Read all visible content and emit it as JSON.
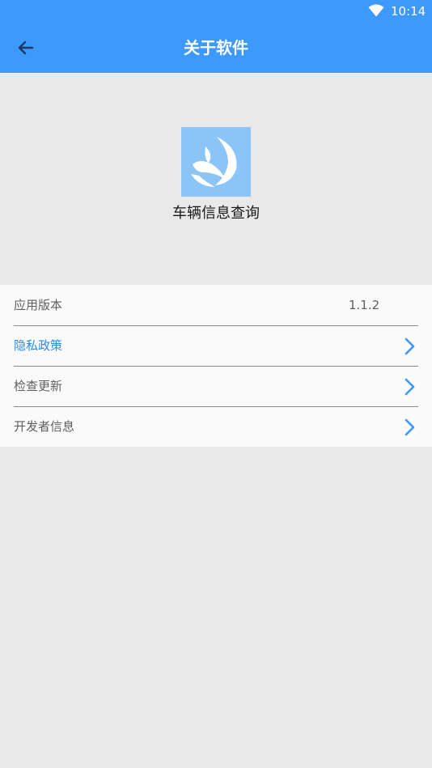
{
  "status_bar": {
    "time": "10:14",
    "wifi_icon": "wifi-icon"
  },
  "toolbar": {
    "back_icon": "back-arrow-icon",
    "title": "关于软件"
  },
  "app": {
    "logo_icon": "leaf-logo-icon",
    "name": "车辆信息查询"
  },
  "settings": {
    "version_label": "应用版本",
    "version_value": "1.1.2",
    "privacy_label": "隐私政策",
    "update_label": "检查更新",
    "developer_label": "开发者信息",
    "chevron_icon": "chevron-right-icon"
  },
  "colors": {
    "primary": "#3d99fc",
    "link": "#2b8de8",
    "background": "#e9e9e9",
    "list_background": "#fafafa",
    "logo_background": "#8bc4f7"
  }
}
